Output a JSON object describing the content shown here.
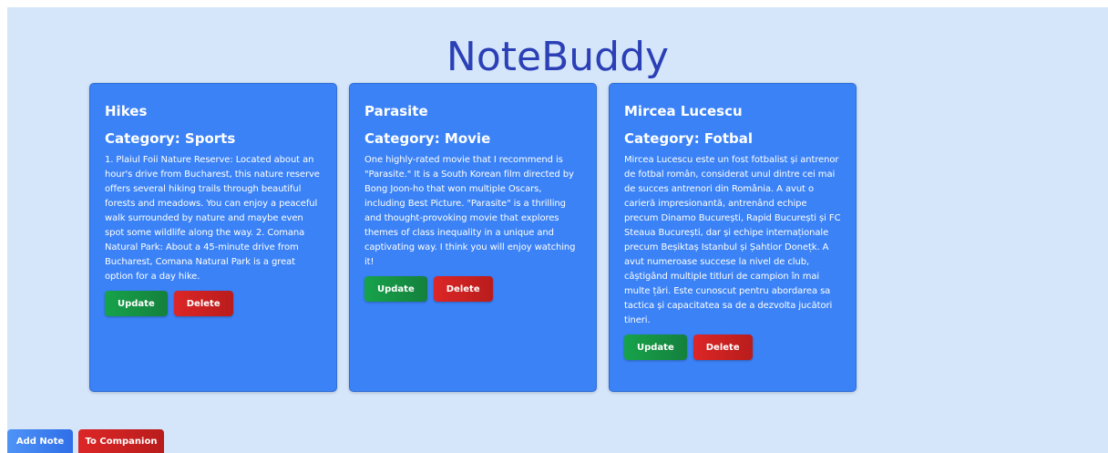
{
  "app": {
    "title": "NoteBuddy"
  },
  "notes": [
    {
      "title": "Hikes",
      "category": "Category: Sports",
      "content": "1. Plaiul Foii Nature Reserve: Located about an hour's drive from Bucharest, this nature reserve offers several hiking trails through beautiful forests and meadows. You can enjoy a peaceful walk surrounded by nature and maybe even spot some wildlife along the way. 2. Comana Natural Park: About a 45-minute drive from Bucharest, Comana Natural Park is a great option for a day hike.",
      "update_label": "Update",
      "delete_label": "Delete"
    },
    {
      "title": "Parasite",
      "category": "Category: Movie",
      "content": "One highly-rated movie that I recommend is \"Parasite.\" It is a South Korean film directed by Bong Joon-ho that won multiple Oscars, including Best Picture. \"Parasite\" is a thrilling and thought-provoking movie that explores themes of class inequality in a unique and captivating way. I think you will enjoy watching it!",
      "update_label": "Update",
      "delete_label": "Delete"
    },
    {
      "title": "Mircea Lucescu",
      "category": "Category: Fotbal",
      "content": "Mircea Lucescu este un fost fotbalist și antrenor de fotbal român, considerat unul dintre cei mai de succes antrenori din România. A avut o carieră impresionantă, antrenând echipe precum Dinamo București, Rapid București și FC Steaua București, dar și echipe internaționale precum Beșiktaș Istanbul și Șahtior Donețk. A avut numeroase succese la nivel de club, câștigând multiple titluri de campion în mai multe țări. Este cunoscut pentru abordarea sa tactica și capacitatea sa de a dezvolta jucători tineri.",
      "update_label": "Update",
      "delete_label": "Delete"
    }
  ],
  "footer": {
    "add_note_label": "Add Note",
    "companion_label": "To Companion"
  },
  "colors": {
    "background": "#d5e5fa",
    "title": "#2b40b6",
    "card": "#3b82f6",
    "update": "#16a34a",
    "delete": "#dc2626"
  }
}
